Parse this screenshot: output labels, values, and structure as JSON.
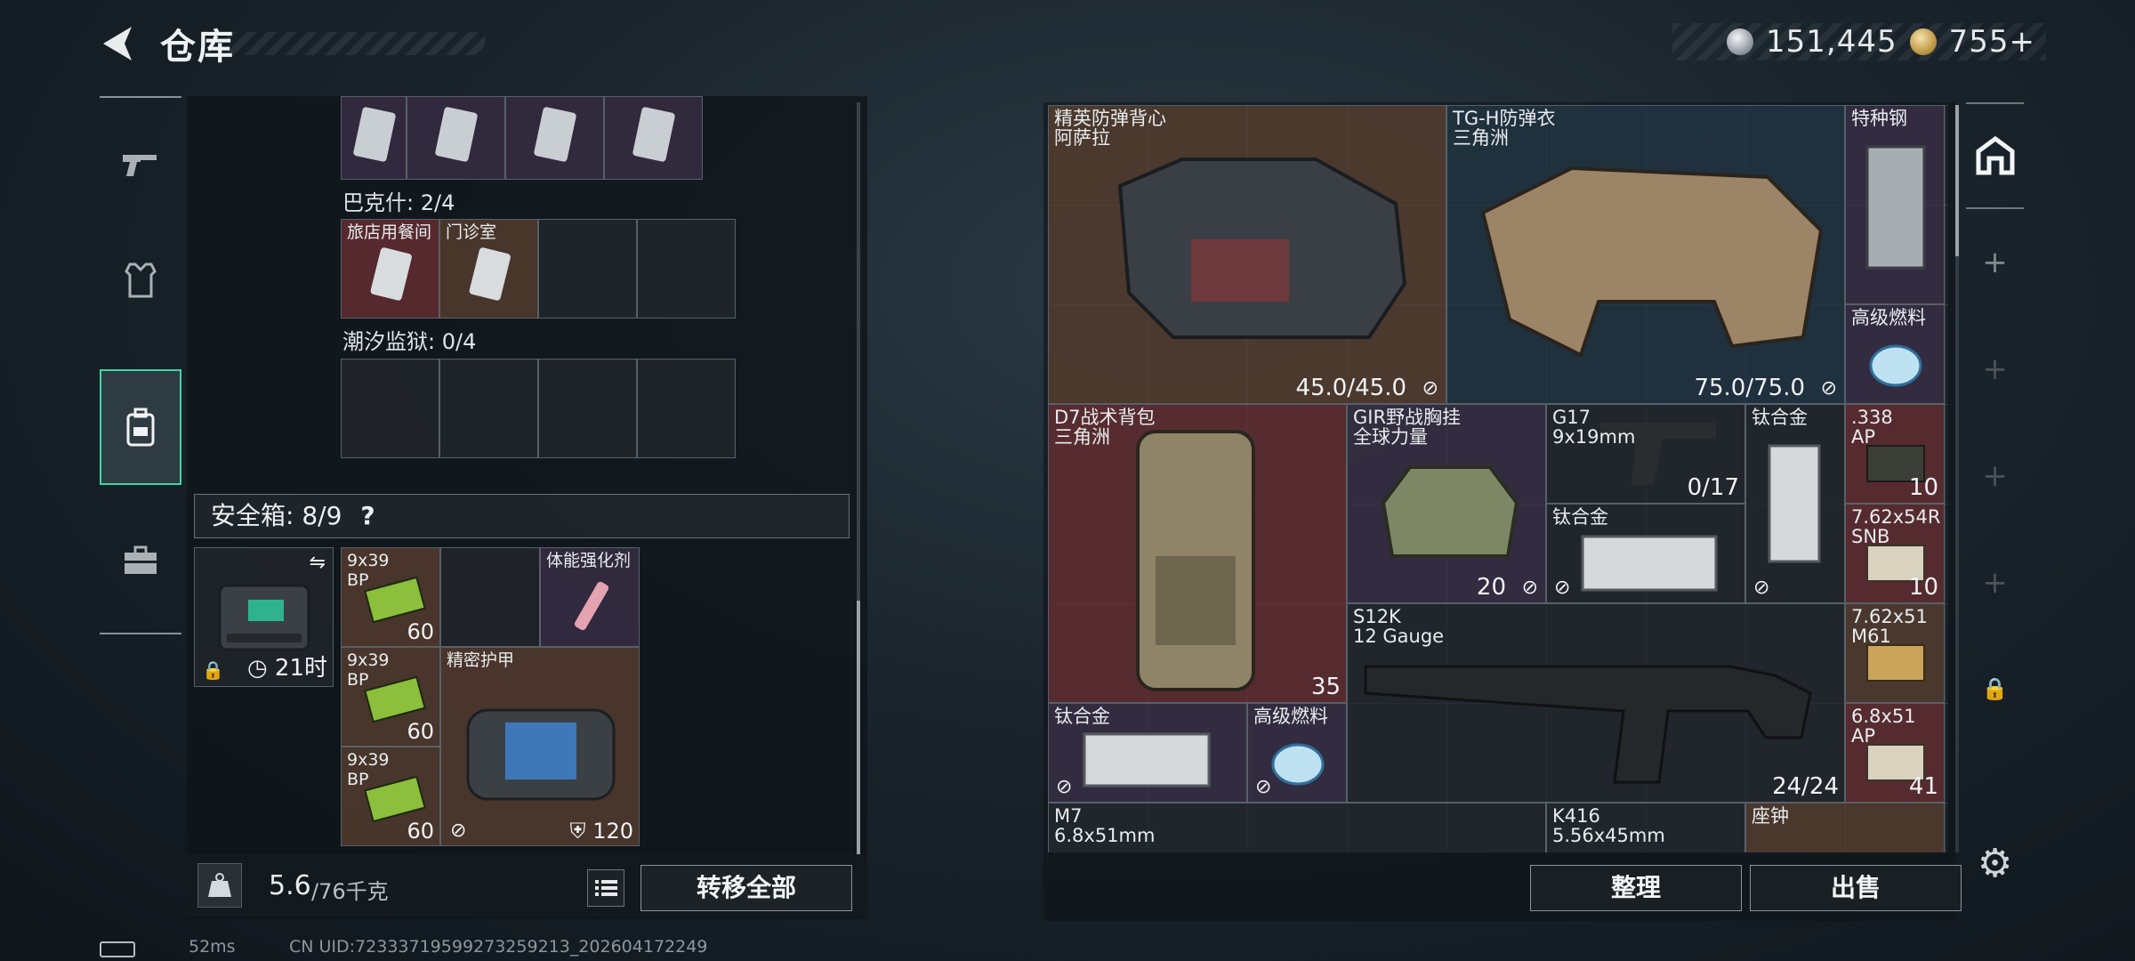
{
  "header": {
    "title": "仓库"
  },
  "currency": [
    {
      "icon": "silver-coin-icon",
      "value": "151,445"
    },
    {
      "icon": "gold-coin-icon",
      "value": "755+"
    }
  ],
  "left_nav": [
    "gun-icon",
    "armor-icon",
    "backpack-icon",
    "toolbox-icon"
  ],
  "left_panel": {
    "top_row_items": [
      "key-card",
      "key-card",
      "key-card",
      "key-card"
    ],
    "bakshi": {
      "label": "巴克什: 2/4",
      "items": [
        "旅店用餐间",
        "门诊室"
      ]
    },
    "tidal_prison": {
      "label": "潮汐监狱: 0/4"
    },
    "safebox": {
      "label": "安全箱: 8/9",
      "help": "?",
      "timer": "21时"
    },
    "safebox_items": [
      {
        "label": "9x39\nBP",
        "count": "60"
      },
      {
        "label": "体能强化剂",
        "count": ""
      },
      {
        "label": "9x39\nBP",
        "count": "60"
      },
      {
        "label": "精密护甲",
        "count": "120"
      },
      {
        "label": "9x39\nBP",
        "count": "60"
      }
    ],
    "weight": {
      "value": "5.6",
      "max": "/76千克"
    },
    "transfer_all": "转移全部"
  },
  "stash": {
    "items": [
      {
        "label": "精英防弹背心\n阿萨拉",
        "count": "45.0/45.0"
      },
      {
        "label": "TG-H防弹衣\n三角洲",
        "count": "75.0/75.0"
      },
      {
        "label": "特种钢",
        "count": ""
      },
      {
        "label": "高级燃料",
        "count": ""
      },
      {
        "label": "D7战术背包\n三角洲",
        "count": "35"
      },
      {
        "label": "GIR野战胸挂\n全球力量",
        "count": "20"
      },
      {
        "label": "G17\n9x19mm",
        "count": "0/17"
      },
      {
        "label": "钛合金",
        "count": ""
      },
      {
        "label": ".338\nAP",
        "count": "10"
      },
      {
        "label": "钛合金",
        "count": ""
      },
      {
        "label": "7.62x54R\nSNB",
        "count": "10"
      },
      {
        "label": "S12K\n12 Gauge",
        "count": "24/24"
      },
      {
        "label": "7.62x51\nM61",
        "count": ""
      },
      {
        "label": "钛合金",
        "count": ""
      },
      {
        "label": "高级燃料",
        "count": ""
      },
      {
        "label": "6.8x51\nAP",
        "count": "41"
      },
      {
        "label": "M7\n6.8x51mm",
        "count": ""
      },
      {
        "label": "K416\n5.56x45mm",
        "count": ""
      },
      {
        "label": "座钟",
        "count": ""
      }
    ],
    "organize": "整理",
    "sell": "出售"
  },
  "right_nav": [
    "stash-icon",
    "plus-icon",
    "plus-icon",
    "plus-icon",
    "plus-icon",
    "lock-icon",
    "settings-icon"
  ],
  "status": {
    "ping": "52ms",
    "uid": "CN UID:72333719599273259213_202604172249"
  },
  "colors": {
    "accent": "#3fd6a8",
    "brown_cell": "#5c4030",
    "red_cell": "#662e32",
    "purple_cell": "#3c3048",
    "blue_cell": "#223444"
  }
}
